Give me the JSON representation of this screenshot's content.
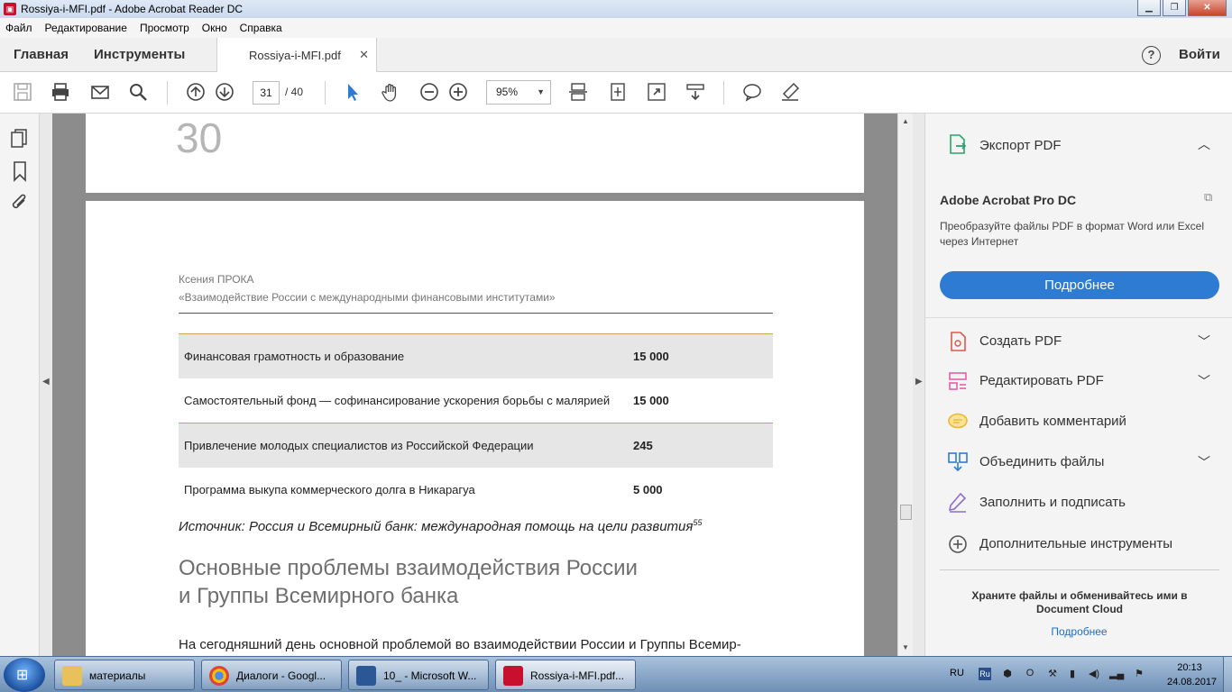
{
  "window": {
    "title": "Rossiya-i-MFI.pdf - Adobe Acrobat Reader DC"
  },
  "menu": [
    "Файл",
    "Редактирование",
    "Просмотр",
    "Окно",
    "Справка"
  ],
  "tabs": {
    "home": "Главная",
    "tools": "Инструменты",
    "document": "Rossiya-i-MFI.pdf",
    "signin": "Войти",
    "help": "?"
  },
  "toolbar": {
    "page_current": "31",
    "page_total": "/ 40",
    "zoom": "95%"
  },
  "document": {
    "prev_page_number": "30",
    "header_author": "Ксения ПРОКА",
    "header_title": "«Взаимодействие России с международными финансовыми институтами»",
    "table": [
      {
        "name": "Финансовая грамотность и образование",
        "value": "15 000"
      },
      {
        "name": "Самостоятельный фонд — софинансирование ускорения борьбы с малярией",
        "value": "15 000"
      },
      {
        "name": "Привлечение молодых специалистов из Российской Федерации",
        "value": "245"
      },
      {
        "name": "Программа выкупа коммерческого долга в Никарагуа",
        "value": "5 000"
      }
    ],
    "source": "Источник: Россия и Всемирный банк: международная помощь на цели развития",
    "source_ref": "55",
    "section_line1": "Основные проблемы взаимодействия России",
    "section_line2": "и Группы Всемирного банка",
    "body": "На сегодняшний день основной проблемой во взаимодействии России и Группы Всемир-"
  },
  "right_panel": {
    "export": "Экспорт PDF",
    "pro_title": "Adobe Acrobat Pro DC",
    "pro_desc": "Преобразуйте файлы PDF в формат Word или Excel через Интернет",
    "pro_button": "Подробнее",
    "tools": [
      {
        "label": "Создать PDF",
        "icon": "create-pdf-icon",
        "color": "#e0574a"
      },
      {
        "label": "Редактировать PDF",
        "icon": "edit-pdf-icon",
        "color": "#e65fa6"
      },
      {
        "label": "Добавить комментарий",
        "icon": "comment-icon",
        "color": "#f2b52f"
      },
      {
        "label": "Объединить файлы",
        "icon": "combine-icon",
        "color": "#2d7bd3"
      },
      {
        "label": "Заполнить и подписать",
        "icon": "sign-icon",
        "color": "#8a6fd1"
      },
      {
        "label": "Дополнительные инструменты",
        "icon": "more-tools-icon",
        "color": "#555555"
      }
    ],
    "store_text": "Храните файлы и обменивайтесь ими в Document Cloud",
    "store_link": "Подробнее"
  },
  "taskbar": {
    "tasks": [
      "материалы",
      "Диалоги - Googl...",
      "10_ - Microsoft W...",
      "Rossiya-i-MFI.pdf..."
    ],
    "lang": "RU",
    "time": "20:13",
    "date": "24.08.2017"
  }
}
